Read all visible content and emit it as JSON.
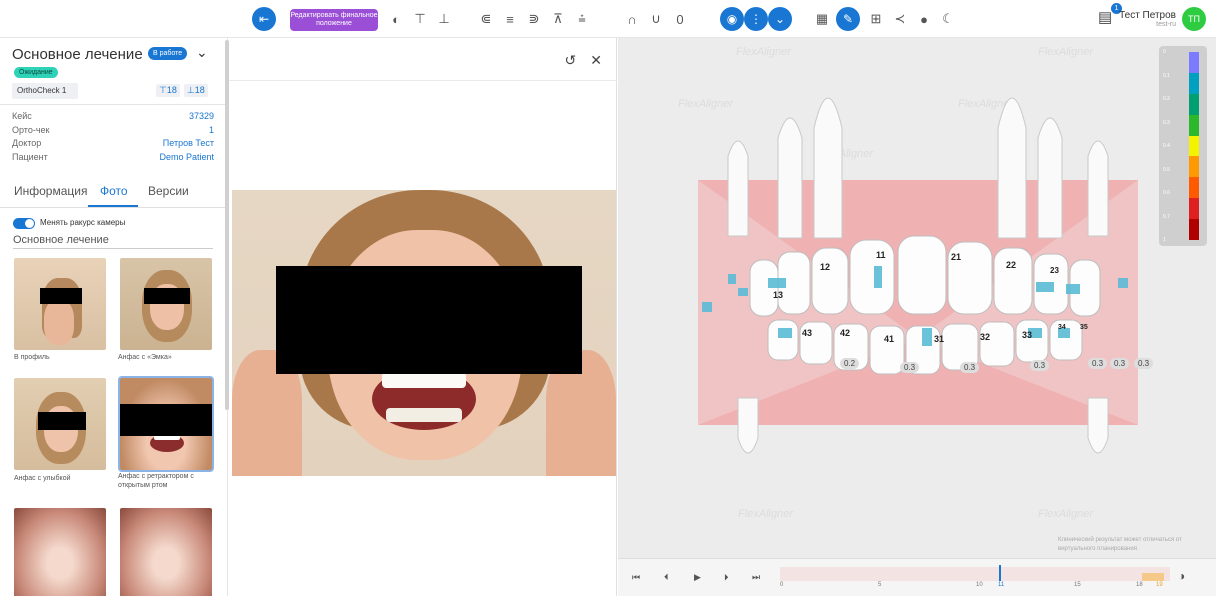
{
  "toolbar": {
    "edit_final_label": "Редактировать финальное положение"
  },
  "user": {
    "name": "Тест Петров",
    "sub": "test-ru",
    "initials": "ТП",
    "notif_count": "1"
  },
  "sidebar": {
    "title": "Основное лечение",
    "status_badge": "В работе",
    "wait_badge": "Ожидание",
    "orthocheck": "OrthoCheck 1",
    "upper_count": "18",
    "lower_count": "18",
    "info": [
      {
        "k": "Кейс",
        "v": "37329"
      },
      {
        "k": "Орто-чек",
        "v": "1"
      },
      {
        "k": "Доктор",
        "v": "Петров Тест"
      },
      {
        "k": "Пациент",
        "v": "Demo Patient"
      }
    ],
    "tabs": [
      "Информация",
      "Фото",
      "Версии"
    ],
    "toggle_label": "Менять ракурс камеры",
    "section_title": "Основное лечение",
    "photos": [
      {
        "caption": "В профиль"
      },
      {
        "caption": "Анфас с «Эмка»"
      },
      {
        "caption": "Анфас с улыбкой"
      },
      {
        "caption": "Анфас с ретрактором с открытым ртом"
      }
    ]
  },
  "view3d": {
    "watermark": "FlexAligner",
    "scale_labels": [
      "0",
      "0.1",
      "0.2",
      "0.3",
      "0.4",
      "0.5",
      "0.6",
      "0.7",
      "1"
    ],
    "scale_colors": [
      "#7b7bff",
      "#00a0c0",
      "#00a070",
      "#2bb82b",
      "#f3f300",
      "#ff9900",
      "#ff5a00",
      "#e02020",
      "#b00000"
    ],
    "disclaimer": "Клинический результат может отличаться от виртуального планирования",
    "tooth_labels": [
      "13",
      "12",
      "11",
      "21",
      "22",
      "23",
      "43",
      "42",
      "41",
      "31",
      "32",
      "33",
      "34",
      "35"
    ],
    "measurements": [
      "0.2",
      "0.3",
      "0.3",
      "0.3",
      "0.3",
      "0.3",
      "0.3"
    ]
  },
  "player": {
    "ticks": [
      "0",
      "5",
      "10",
      "11",
      "15",
      "18",
      "19"
    ]
  }
}
